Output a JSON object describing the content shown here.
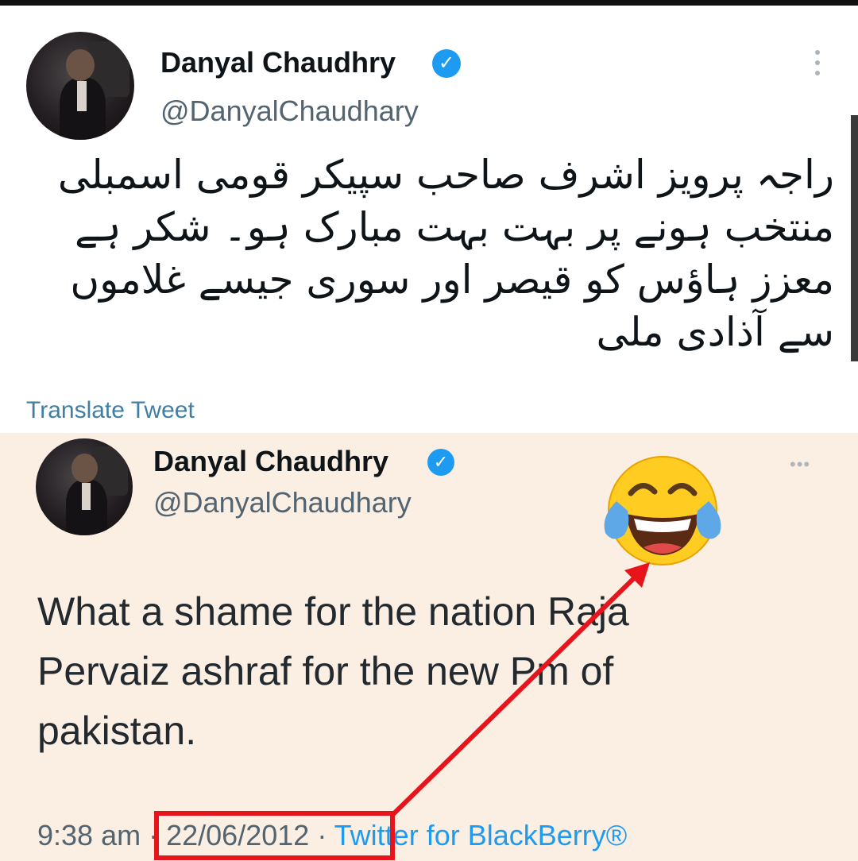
{
  "tweet_top": {
    "display_name": "Danyal Chaudhry",
    "handle": "@DanyalChaudhary",
    "text": "راجہ پرویز اشرف صاحب سپیکر قومی اسمبلی منتخب ہونے پر بہت بہت مبارک ہو۔ شکر ہے معزز ہاؤس کو قیصر اور سوری جیسے غلاموں سے آذادی ملی",
    "translate_label": "Translate Tweet",
    "verified_icon": "verified-badge-icon",
    "more_icon": "more-vertical-icon"
  },
  "tweet_bottom": {
    "display_name": "Danyal Chaudhry",
    "handle": "@DanyalChaudhary",
    "text": "What a shame for the nation Raja Pervaiz ashraf for the new Pm of pakistan.",
    "time": "9:38 am",
    "separator": "·",
    "date": "22/06/2012",
    "source": "Twitter for BlackBerry®",
    "more_icon": "more-horizontal-icon"
  },
  "annotation": {
    "emoji": "face-with-tears-of-joy-icon",
    "highlight_color": "#e8141b",
    "arrow_color": "#e8141b"
  },
  "colors": {
    "verified_blue": "#1d9bf0",
    "translate_link": "#3f7fa4",
    "bottom_background": "#fbeee2"
  }
}
